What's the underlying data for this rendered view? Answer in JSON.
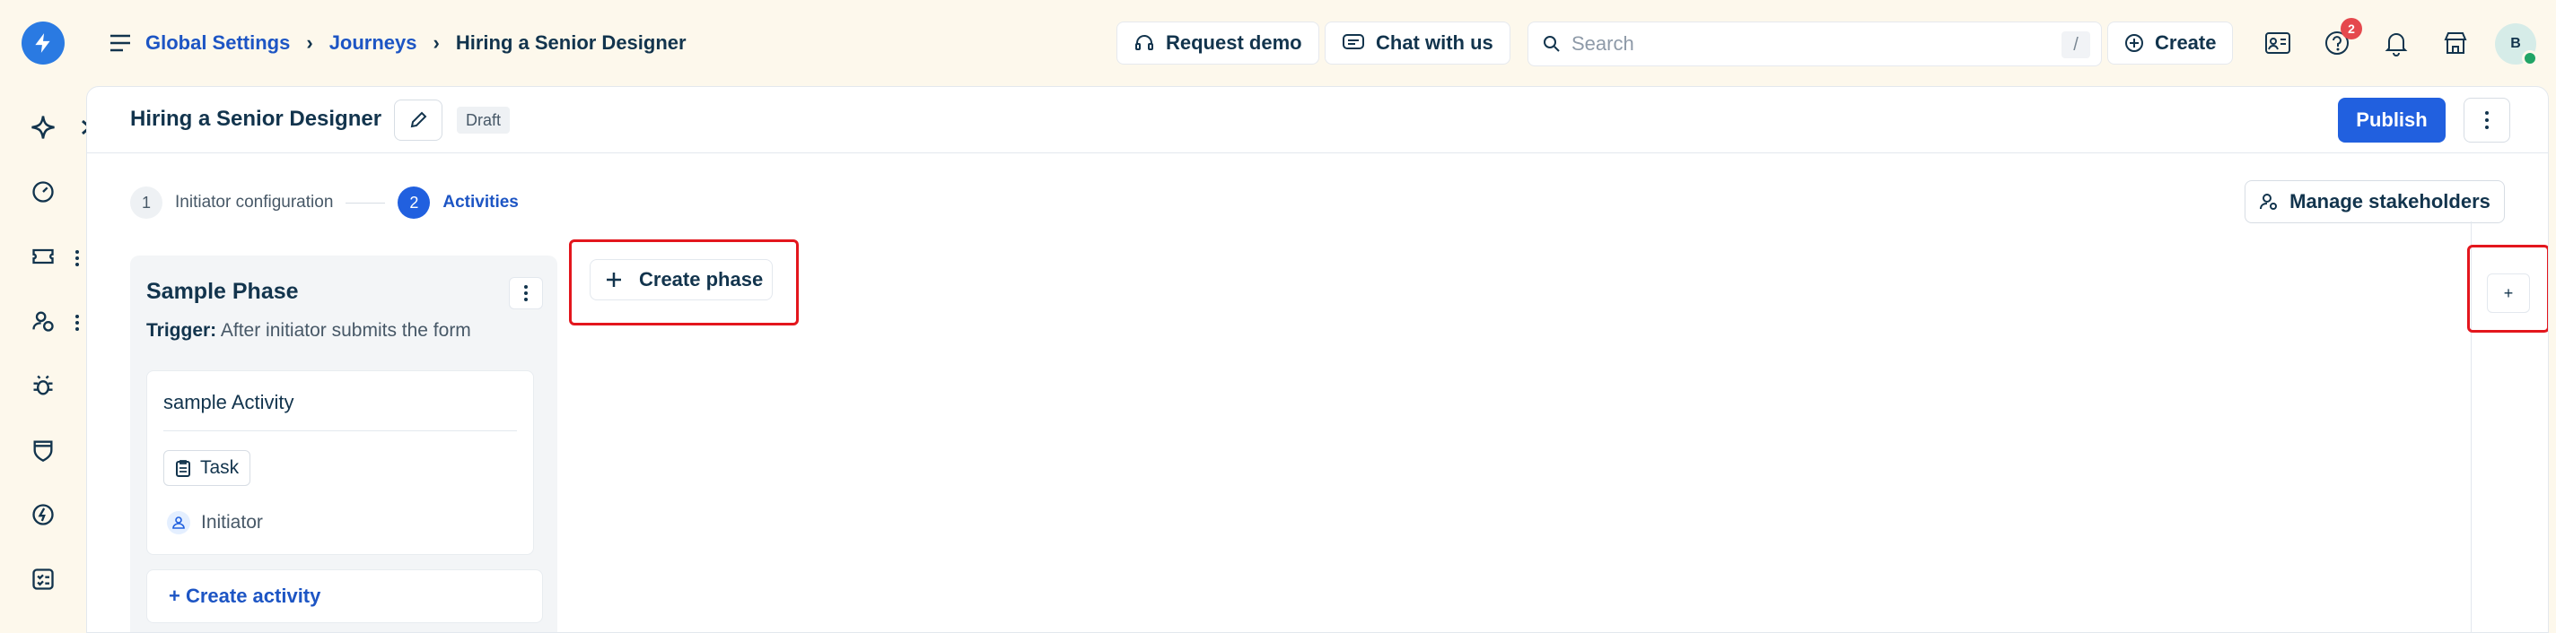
{
  "breadcrumb": {
    "items": [
      "Global Settings",
      "Journeys",
      "Hiring a Senior Designer"
    ],
    "separator": "›"
  },
  "header": {
    "request_demo": "Request demo",
    "chat": "Chat with us",
    "search_placeholder": "Search",
    "search_shortcut": "/",
    "create": "Create",
    "help_badge": "2",
    "avatar_initial": "B"
  },
  "page": {
    "title": "Hiring a Senior Designer",
    "status": "Draft",
    "publish": "Publish"
  },
  "stepper": {
    "steps": [
      {
        "number": "1",
        "label": "Initiator configuration",
        "state": "done"
      },
      {
        "number": "2",
        "label": "Activities",
        "state": "active"
      }
    ]
  },
  "manage_stakeholders": "Manage stakeholders",
  "phase": {
    "title": "Sample Phase",
    "trigger_label": "Trigger:",
    "trigger_text": "After initiator submits the form",
    "activity": {
      "title": "sample Activity",
      "type": "Task",
      "assignee": "Initiator"
    },
    "create_activity": "+ Create activity"
  },
  "create_phase": "Create phase",
  "side_add": "+",
  "colors": {
    "brand": "#2a7ae2",
    "primary": "#2160df",
    "link": "#1d55c4",
    "highlight": "#e3161d",
    "background": "#fdf8ec"
  }
}
